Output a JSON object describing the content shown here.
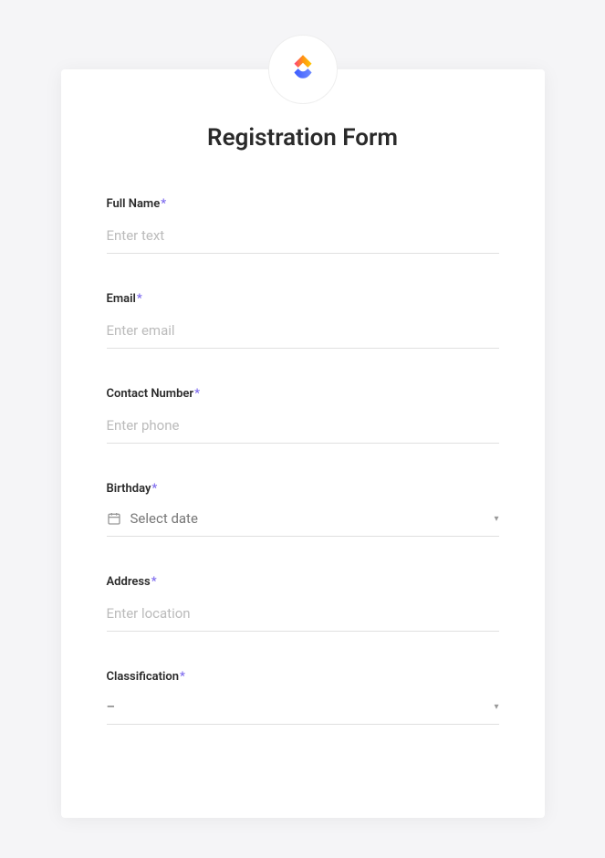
{
  "title": "Registration Form",
  "required_marker": "*",
  "fields": {
    "full_name": {
      "label": "Full Name",
      "placeholder": "Enter text"
    },
    "email": {
      "label": "Email",
      "placeholder": "Enter email"
    },
    "contact_number": {
      "label": "Contact Number",
      "placeholder": "Enter phone"
    },
    "birthday": {
      "label": "Birthday",
      "placeholder": "Select date"
    },
    "address": {
      "label": "Address",
      "placeholder": "Enter location"
    },
    "classification": {
      "label": "Classification",
      "placeholder": "–"
    }
  }
}
